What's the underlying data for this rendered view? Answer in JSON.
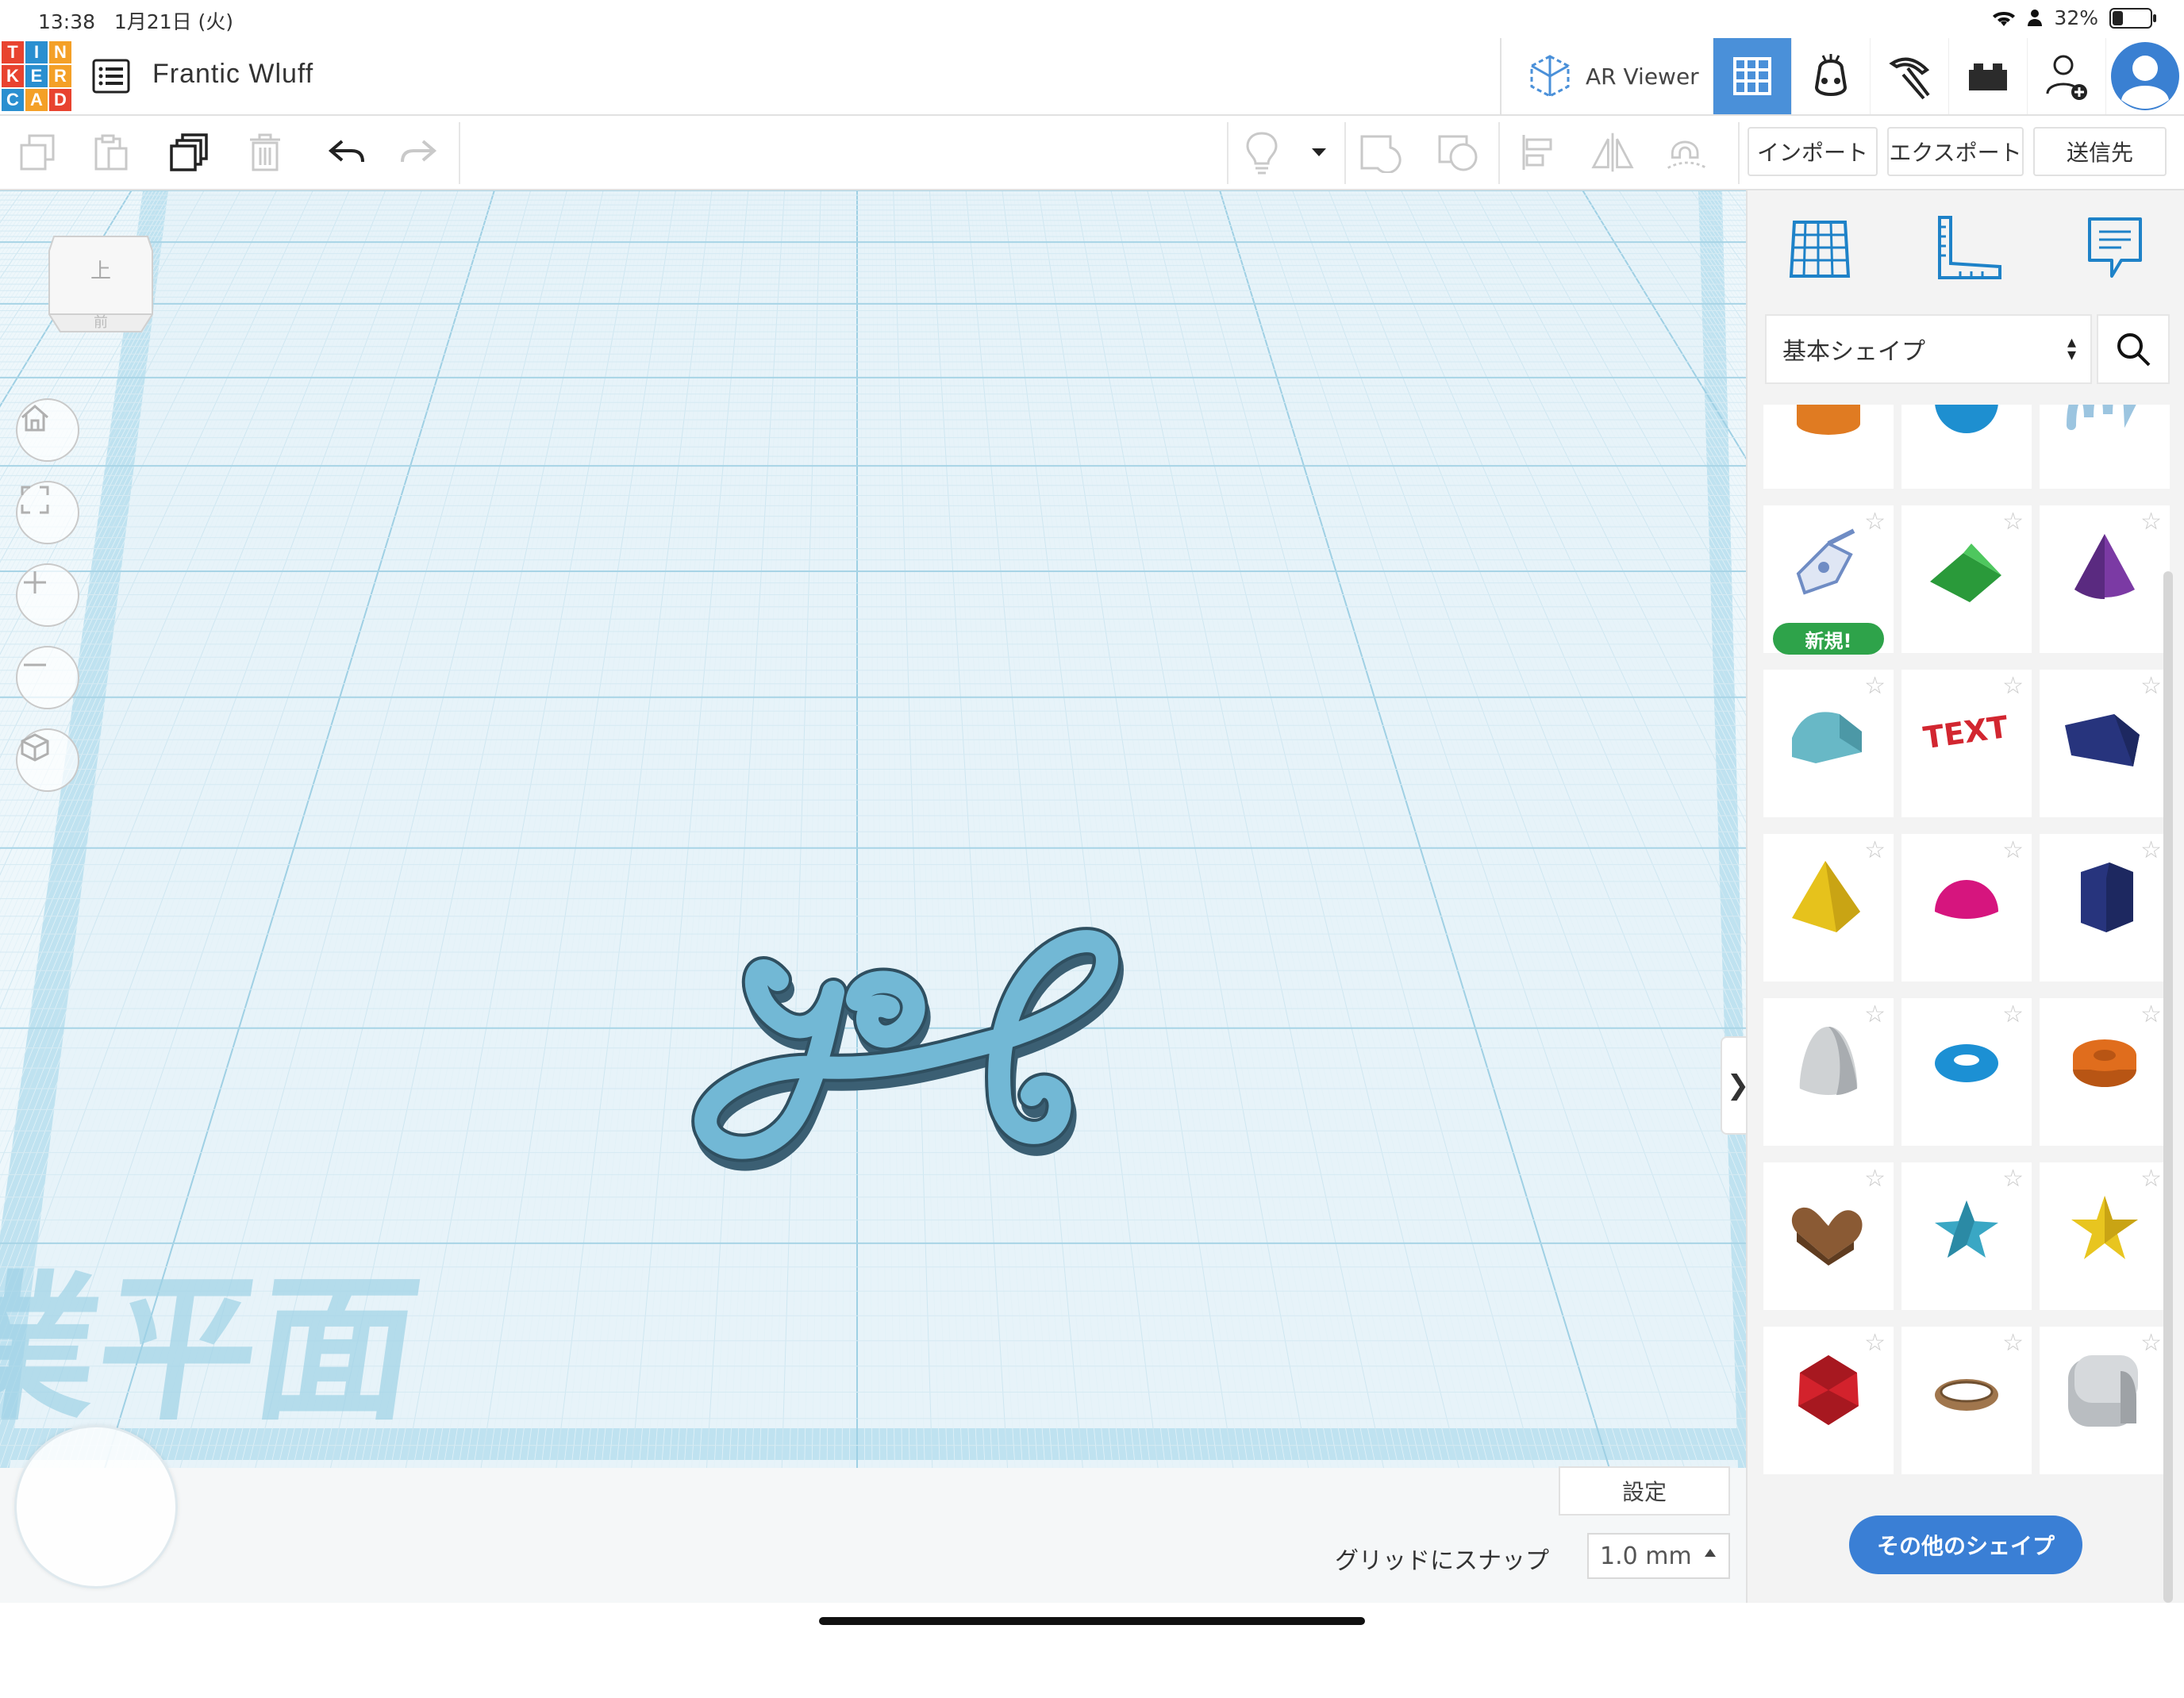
{
  "status_bar": {
    "time": "13:38",
    "date": "1月21日 (火)",
    "battery": "32%",
    "battery_level": 0.32
  },
  "app": {
    "logo_letters": [
      "T",
      "I",
      "N",
      "K",
      "E",
      "R",
      "C",
      "A",
      "D"
    ],
    "logo_colors": [
      "#e8432f",
      "#2a8fd0",
      "#f4a027",
      "#e8432f",
      "#2a8fd0",
      "#f4a027",
      "#2a8fd0",
      "#f4a027",
      "#e8432f"
    ],
    "design_title": "Frantic Wluff",
    "ar_viewer_label": "AR Viewer",
    "accent": "#4a90d9"
  },
  "topbar_icons": [
    "ar-viewer-icon",
    "3d-grid-view-icon",
    "codeblocks-icon",
    "minecraft-pickaxe-icon",
    "brick-icon",
    "add-user-icon",
    "avatar"
  ],
  "toolbar": {
    "left_icons": [
      "copy-icon",
      "paste-icon",
      "duplicate-icon",
      "delete-icon",
      "undo-icon",
      "redo-icon"
    ],
    "right_icons": [
      "lightbulb-icon",
      "dropdown-arrow-icon",
      "group-icon",
      "ungroup-icon",
      "align-icon",
      "mirror-icon",
      "magnet-icon"
    ],
    "import_label": "インポート",
    "export_label": "エクスポート",
    "send_label": "送信先"
  },
  "workplane": {
    "viewcube_top": "上",
    "viewcube_front": "前",
    "watermark": "作業平面",
    "object_text": "yog",
    "nav_buttons": [
      "home-icon",
      "fit-icon",
      "zoom-in-icon",
      "zoom-out-icon",
      "perspective-icon"
    ]
  },
  "footer": {
    "settings_label": "設定",
    "snap_label": "グリッドにスナップ",
    "snap_value": "1.0 mm"
  },
  "panel": {
    "tab_icons": [
      "workplane-grid-icon",
      "ruler-icon",
      "notes-icon"
    ],
    "category_selected": "基本シェイプ",
    "new_badge": "新規!",
    "more_shapes_label": "その他のシェイプ",
    "shapes": [
      {
        "name": "cylinder",
        "color": "#e07b22"
      },
      {
        "name": "sphere",
        "color": "#1e8fd0"
      },
      {
        "name": "scribble",
        "color": "#9cc5e0"
      },
      {
        "name": "sketch",
        "color": "#6f8cc4"
      },
      {
        "name": "roof",
        "color": "#2a9a3a"
      },
      {
        "name": "cone",
        "color": "#7b3aa4"
      },
      {
        "name": "round-roof",
        "color": "#68b8c6"
      },
      {
        "name": "text",
        "color": "#d22630"
      },
      {
        "name": "box",
        "color": "#27347d"
      },
      {
        "name": "pyramid",
        "color": "#e6c21c"
      },
      {
        "name": "half-sphere",
        "color": "#d6157e"
      },
      {
        "name": "polygon",
        "color": "#27347d"
      },
      {
        "name": "paraboloid",
        "color": "#cfd2d4"
      },
      {
        "name": "torus",
        "color": "#1c90d4"
      },
      {
        "name": "tube",
        "color": "#e06d1d"
      },
      {
        "name": "heart",
        "color": "#8a5a34"
      },
      {
        "name": "star",
        "color": "#3aa7c4"
      },
      {
        "name": "star-yellow",
        "color": "#e8c51f"
      },
      {
        "name": "icosahedron",
        "color": "#d3222c"
      },
      {
        "name": "ring",
        "color": "#a0764d"
      },
      {
        "name": "rounded-box",
        "color": "#b9bdc1"
      }
    ]
  }
}
